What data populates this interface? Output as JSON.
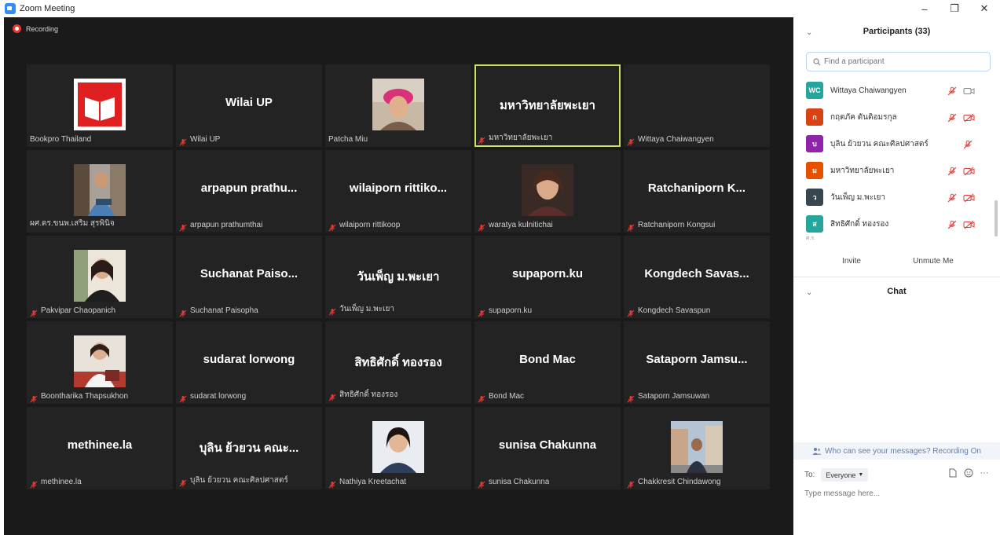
{
  "window": {
    "title": "Zoom Meeting",
    "minimize": "–",
    "maximize": "❐",
    "close": "✕"
  },
  "recording": {
    "label": "Recording",
    "color": "#e53935"
  },
  "tiles": [
    {
      "name": "",
      "label": "Bookpro Thailand",
      "muted": false,
      "photo": "book-logo"
    },
    {
      "name": "Wilai UP",
      "label": "Wilai UP",
      "muted": true
    },
    {
      "name": "",
      "label": "Patcha Miu",
      "muted": false,
      "photo": "woman-pink-hat"
    },
    {
      "name": "มหาวิทยาลัยพะเยา",
      "label": "มหาวิทยาลัยพะเยา",
      "muted": true,
      "active": true
    },
    {
      "name": "",
      "label": "Wittaya Chaiwangyen",
      "muted": true
    },
    {
      "name": "",
      "label": "ผศ.ดร.ขนพ.เสริม สุรพินิจ",
      "muted": false,
      "photo": "man-seated"
    },
    {
      "name": "arpapun prathu...",
      "label": "arpapun prathumthai",
      "muted": true
    },
    {
      "name": "wilaiporn rittiko...",
      "label": "wilaiporn rittikoop",
      "muted": true
    },
    {
      "name": "",
      "label": "waratya kulnitichai",
      "muted": true,
      "photo": "woman-portrait"
    },
    {
      "name": "Ratchaniporn K...",
      "label": "Ratchaniporn Kongsui",
      "muted": true
    },
    {
      "name": "",
      "label": "Pakvipar Chaopanich",
      "muted": true,
      "photo": "woman-black-shirt"
    },
    {
      "name": "Suchanat Paiso...",
      "label": "Suchanat Paisopha",
      "muted": true
    },
    {
      "name": "วันเพ็ญ ม.พะเยา",
      "label": "วันเพ็ญ ม.พะเยา",
      "muted": true
    },
    {
      "name": "supaporn.ku",
      "label": "supaporn.ku",
      "muted": true
    },
    {
      "name": "Kongdech Savas...",
      "label": "Kongdech Savaspun",
      "muted": true
    },
    {
      "name": "",
      "label": "Boontharika Thapsukhon",
      "muted": true,
      "photo": "woman-red-shirt"
    },
    {
      "name": "sudarat lorwong",
      "label": "sudarat lorwong",
      "muted": true
    },
    {
      "name": "สิทธิศักดิ์ ทองรอง",
      "label": "สิทธิศักดิ์ ทองรอง",
      "muted": true
    },
    {
      "name": "Bond Mac",
      "label": "Bond Mac",
      "muted": true
    },
    {
      "name": "Sataporn Jamsu...",
      "label": "Sataporn Jamsuwan",
      "muted": true
    },
    {
      "name": "methinee.la",
      "label": "methinee.la",
      "muted": true
    },
    {
      "name": "บุลิน ย้วยวน คณะ...",
      "label": "บุลิน ย้วยวน คณะศิลปศาสตร์",
      "muted": true
    },
    {
      "name": "",
      "label": "Nathiya Kreetachat",
      "muted": true,
      "photo": "woman-smiling"
    },
    {
      "name": "sunisa Chakunna",
      "label": "sunisa Chakunna",
      "muted": true
    },
    {
      "name": "",
      "label": "Chakkresit Chindawong",
      "muted": true,
      "photo": "man-street"
    }
  ],
  "participants_panel": {
    "title": "Participants (33)",
    "search_placeholder": "Find a participant",
    "items": [
      {
        "initials": "WC",
        "color": "#26a69a",
        "name": "Wittaya Chaiwangyen",
        "cam_off": false
      },
      {
        "initials": "ก",
        "color": "#d84315",
        "name": "กฤตภัค ตันติอมรกุล",
        "cam_off": true
      },
      {
        "initials": "บ",
        "color": "#8e24aa",
        "name": "บุลิน ย้วยวน คณะศิลปศาสตร์",
        "cam": false
      },
      {
        "initials": "ม",
        "color": "#e65100",
        "name": "มหาวิทยาลัยพะเยา",
        "cam_off": true
      },
      {
        "initials": "ว",
        "color": "#37474f",
        "name": "วันเพ็ญ ม.พะเยา",
        "cam_off": true
      },
      {
        "initials": "ส",
        "color": "#26a69a",
        "name": "สิทธิศักดิ์ ทองรอง",
        "cam_off": true
      }
    ],
    "more_indicator": "ศ.ร.",
    "invite_label": "Invite",
    "unmute_label": "Unmute Me"
  },
  "chat": {
    "title": "Chat",
    "visibility_text": "Who can see your messages? Recording On",
    "to_label": "To:",
    "recipient": "Everyone",
    "input_placeholder": "Type message here..."
  }
}
